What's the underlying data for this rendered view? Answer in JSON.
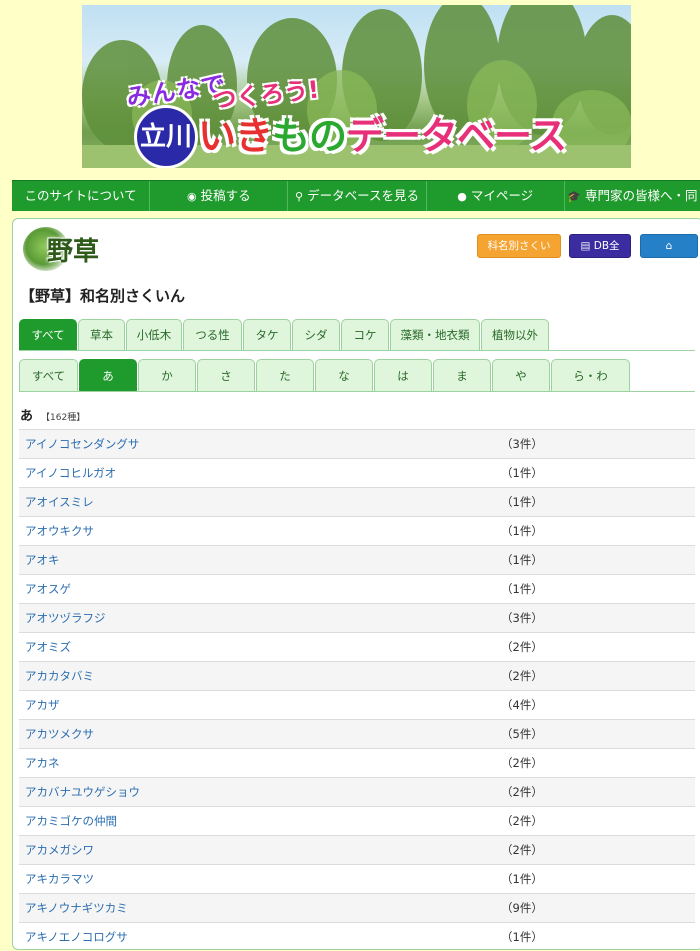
{
  "banner": {
    "line1a": "みんなで",
    "line1b": "つくろう!",
    "circle": "立川",
    "main_a": "いき",
    "main_b": "もの",
    "main_c": "データベース"
  },
  "nav": [
    {
      "icon": "",
      "label": "このサイトについて"
    },
    {
      "icon": "◉",
      "label": "投稿する"
    },
    {
      "icon": "⚲",
      "label": "データベースを見る"
    },
    {
      "icon": "●",
      "label": "マイページ"
    },
    {
      "icon": "🎓",
      "label": "専門家の皆様へ・同"
    }
  ],
  "page": {
    "category_title": "野草",
    "heading": "【野草】和名別さくいん",
    "btn_family_index": "科名別さくいん",
    "btn_db_all": "DB全件",
    "btn_home": "Home"
  },
  "tabs_category": [
    "すべて",
    "草本",
    "小低木",
    "つる性",
    "タケ",
    "シダ",
    "コケ",
    "藻類・地衣類",
    "植物以外"
  ],
  "tabs_kana": [
    "すべて",
    "あ",
    "か",
    "さ",
    "た",
    "な",
    "は",
    "ま",
    "や",
    "ら・わ"
  ],
  "section": {
    "kana": "あ",
    "count": "【162種】"
  },
  "items": [
    {
      "name": "アイノコセンダングサ",
      "count": "（3件）"
    },
    {
      "name": "アイノコヒルガオ",
      "count": "（1件）"
    },
    {
      "name": "アオイスミレ",
      "count": "（1件）"
    },
    {
      "name": "アオウキクサ",
      "count": "（1件）"
    },
    {
      "name": "アオキ",
      "count": "（1件）"
    },
    {
      "name": "アオスゲ",
      "count": "（1件）"
    },
    {
      "name": "アオツヅラフジ",
      "count": "（3件）"
    },
    {
      "name": "アオミズ",
      "count": "（2件）"
    },
    {
      "name": "アカカタバミ",
      "count": "（2件）"
    },
    {
      "name": "アカザ",
      "count": "（4件）"
    },
    {
      "name": "アカツメクサ",
      "count": "（5件）"
    },
    {
      "name": "アカネ",
      "count": "（2件）"
    },
    {
      "name": "アカバナユウゲショウ",
      "count": "（2件）"
    },
    {
      "name": "アカミゴケの仲間",
      "count": "（2件）"
    },
    {
      "name": "アカメガシワ",
      "count": "（2件）"
    },
    {
      "name": "アキカラマツ",
      "count": "（1件）"
    },
    {
      "name": "アキノウナギツカミ",
      "count": "（9件）"
    },
    {
      "name": "アキノエノコログサ",
      "count": "（1件）"
    }
  ],
  "colors": {
    "page_bg": "#ffffc8",
    "nav_green": "#1f9a2d",
    "tab_light": "#dff5dc",
    "link": "#2a6db0",
    "btn_orange": "#f5a431",
    "btn_indigo": "#3b2ca0",
    "btn_blue": "#2680c8"
  }
}
